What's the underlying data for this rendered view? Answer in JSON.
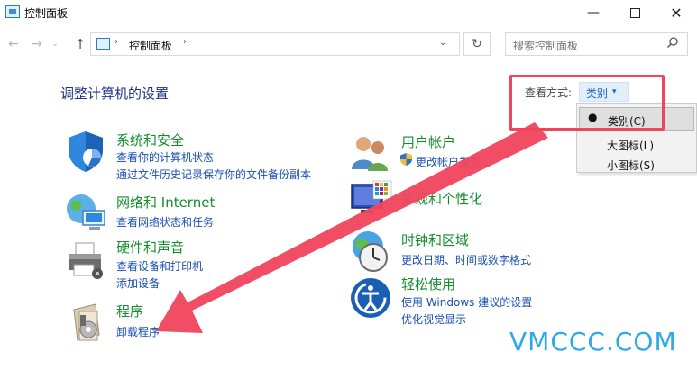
{
  "window": {
    "title": "控制面板",
    "minimize": "—",
    "close": "✕"
  },
  "nav": {
    "back": "←",
    "forward": "→",
    "recent": "⌄",
    "up": "↑",
    "refresh": "↻"
  },
  "address": {
    "separator": "›",
    "path": "控制面板",
    "dropdown": "⌄"
  },
  "search": {
    "placeholder": "搜索控制面板",
    "icon": "search-icon"
  },
  "heading": "调整计算机的设置",
  "view_by": {
    "label": "查看方式:",
    "value": "类别",
    "caret": "▾",
    "options": [
      {
        "label": "类别(C)",
        "selected": true,
        "bullet": "●"
      },
      {
        "label": "大图标(L)",
        "selected": false
      },
      {
        "label": "小图标(S)",
        "selected": false
      }
    ]
  },
  "categories": [
    {
      "title": "系统和安全",
      "icon": "shield-icon",
      "links": [
        "查看你的计算机状态",
        "通过文件历史记录保存你的文件备份副本"
      ]
    },
    {
      "title": "网络和 Internet",
      "icon": "network-globe-icon",
      "links": [
        "查看网络状态和任务"
      ]
    },
    {
      "title": "硬件和声音",
      "icon": "printer-icon",
      "links": [
        "查看设备和打印机",
        "添加设备"
      ]
    },
    {
      "title": "程序",
      "icon": "programs-disk-icon",
      "links": [
        "卸载程序"
      ]
    },
    {
      "title": "用户帐户",
      "icon": "users-icon",
      "links": [
        "更改帐户类型"
      ]
    },
    {
      "title": "外观和个性化",
      "icon": "monitor-palette-icon",
      "links": []
    },
    {
      "title": "时钟和区域",
      "icon": "clock-globe-icon",
      "links": [
        "更改日期、时间或数字格式"
      ]
    },
    {
      "title": "轻松使用",
      "icon": "ease-of-access-icon",
      "links": [
        "使用 Windows 建议的设置",
        "优化视觉显示"
      ]
    }
  ],
  "watermark": "VMCCC.COM",
  "colors": {
    "link": "#1a4fb3",
    "category_title": "#148c2c",
    "heading": "#1e3287",
    "highlight": "#f0455e",
    "watermark": "#2fa8e8"
  }
}
